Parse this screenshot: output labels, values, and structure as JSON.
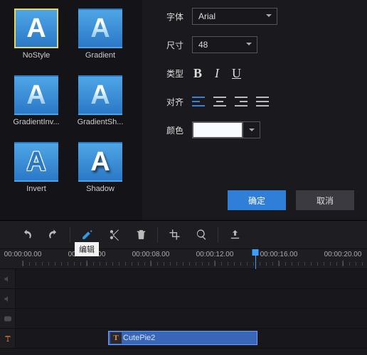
{
  "styles": [
    {
      "label": "NoStyle",
      "variant": "plain",
      "selected": true
    },
    {
      "label": "Gradient",
      "variant": "gradient",
      "selected": false
    },
    {
      "label": "GradientInv...",
      "variant": "gradient",
      "selected": false
    },
    {
      "label": "GradientSh...",
      "variant": "gradient",
      "selected": false
    },
    {
      "label": "Invert",
      "variant": "invert",
      "selected": false
    },
    {
      "label": "Shadow",
      "variant": "shadow",
      "selected": false
    }
  ],
  "props": {
    "font_label": "字体",
    "font_value": "Arial",
    "size_label": "尺寸",
    "size_value": "48",
    "type_label": "类型",
    "align_label": "对齐",
    "color_label": "颜色",
    "color_value": "#f5fbff"
  },
  "dialog": {
    "ok": "确定",
    "cancel": "取消"
  },
  "timeline": {
    "edit_tooltip": "编辑",
    "ticks": [
      "00:00:00.00",
      "00:00:04.00",
      "00:00:08.00",
      "00:00:12.00",
      "00:00:16.00",
      "00:00:20.00"
    ],
    "clip_label": "CutePie2",
    "clip_icon_letter": "T"
  }
}
